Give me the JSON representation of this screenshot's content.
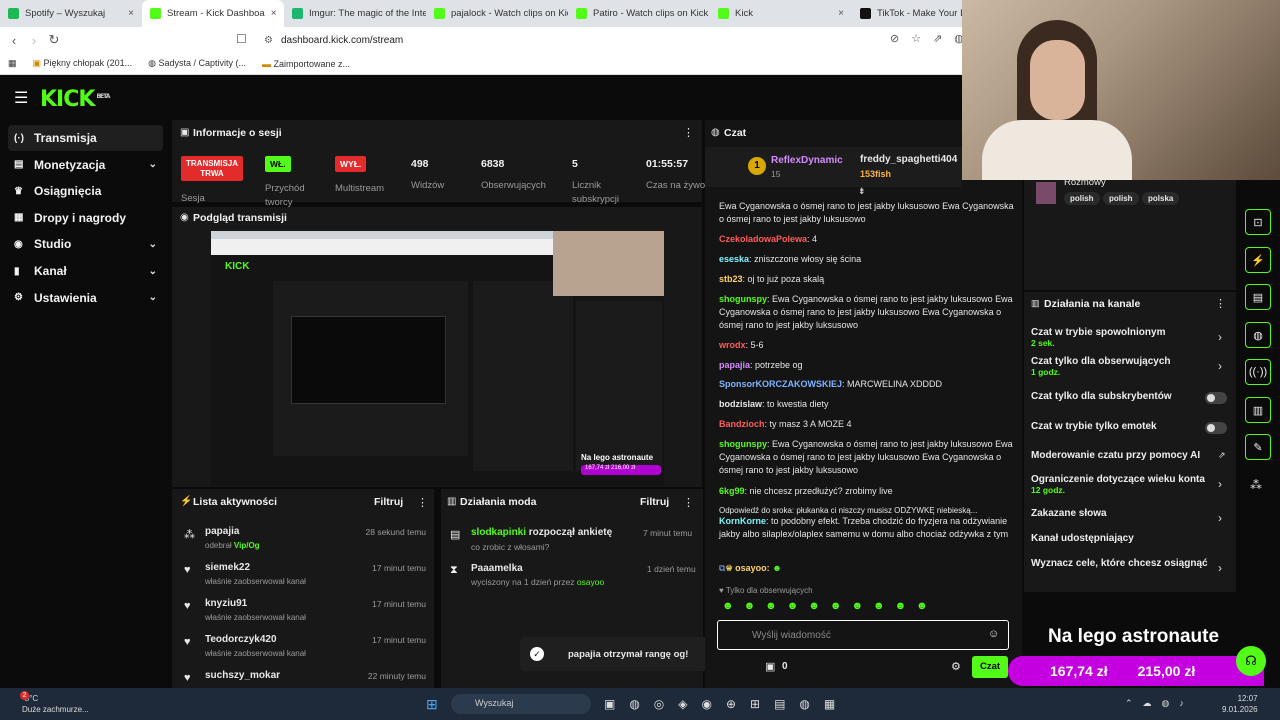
{
  "browser": {
    "tabs": [
      {
        "label": "Spotify – Wyszukaj",
        "color": "#1db954"
      },
      {
        "label": "Stream - Kick Dashboa",
        "color": "#53fc18",
        "active": true
      },
      {
        "label": "Imgur: The magic of the Interne",
        "color": "#1bb76e"
      },
      {
        "label": "pajalock - Watch clips on Kick",
        "color": "#53fc18"
      },
      {
        "label": "Patiro - Watch clips on Kick",
        "color": "#53fc18"
      },
      {
        "label": "Kick",
        "color": "#53fc18"
      },
      {
        "label": "TikTok - Make Your Day",
        "color": "#111111"
      }
    ],
    "url": "dashboard.kick.com/stream",
    "bookmarks": [
      "Piękny chłopak (201...",
      "Sadysta / Captivity (...",
      "Zaimportowane z..."
    ]
  },
  "kick": {
    "logo": "KICK",
    "beta": "BETA",
    "sidebar": [
      {
        "label": "Transmisja",
        "icon": "(·)",
        "selected": true
      },
      {
        "label": "Monetyzacja",
        "icon": "▤",
        "chev": "⌄"
      },
      {
        "label": "Osiągnięcia",
        "icon": "♛"
      },
      {
        "label": "Dropy i nagrody",
        "icon": "▦"
      },
      {
        "label": "Studio",
        "icon": "◉",
        "chev": "⌄"
      },
      {
        "label": "Kanał",
        "icon": "▮",
        "chev": "⌄"
      },
      {
        "label": "Ustawienia",
        "icon": "⚙",
        "chev": "⌄"
      }
    ],
    "session": {
      "title": "Informacje o sesji",
      "live_badge": "TRANSMISJA TRWA",
      "live_sub": "Sesja",
      "subs_badge": "WŁ.",
      "subs_label": "Przychód tworcy",
      "multi_badge": "WYŁ.",
      "multi_label": "Multistream",
      "stats": [
        {
          "value": "498",
          "label": "Widzów"
        },
        {
          "value": "6838",
          "label": "Obserwujących"
        },
        {
          "value": "5",
          "label": "Licznik subskrypcji"
        },
        {
          "value": "01:55:57",
          "label": "Czas na żywo"
        }
      ]
    },
    "preview": {
      "title": "Podgląd transmisji",
      "overlay": "Na lego astronaute",
      "money1": "167,74 zł",
      "money2": "216,00 zł"
    },
    "activity": {
      "title": "Lista aktywności",
      "filter": "Filtruj",
      "items": [
        {
          "user": "papajia",
          "time": "28 sekund temu",
          "desc": "odebrał ",
          "extra": "Vip/Og"
        },
        {
          "user": "siemek22",
          "time": "17 minut temu",
          "desc": "właśnie zaobserwował kanał",
          "extra": ""
        },
        {
          "user": "knyziu91",
          "time": "17 minut temu",
          "desc": "właśnie zaobserwował kanał",
          "extra": ""
        },
        {
          "user": "Teodorczyk420",
          "time": "17 minut temu",
          "desc": "właśnie zaobserwował kanał",
          "extra": ""
        },
        {
          "user": "suchszy_mokar",
          "time": "22 minuty temu",
          "desc": "",
          "extra": ""
        }
      ]
    },
    "mod": {
      "title": "Działania moda",
      "filter": "Filtruj",
      "items": [
        {
          "user": "slodkapinki",
          "action": " rozpoczął ankietę",
          "time": "7 minut temu",
          "desc": "co zrobic z włosami?"
        },
        {
          "user": "Paaamelka",
          "action": "",
          "time": "1 dzień temu",
          "desc": "wyciszony na 1 dzień przez ",
          "by": "osayoo"
        }
      ]
    },
    "toast": "papajia otrzymał rangę og!",
    "chat": {
      "title": "Czat",
      "pinned": [
        {
          "user": "ReflexDynamic",
          "count": "15"
        },
        {
          "user": "freddy_spaghetti404",
          "count": "153fish"
        }
      ],
      "lines": [
        {
          "user": "",
          "color": "#e8e8e8",
          "text": "Ewa Cyganowska o ósmej rano to jest jakby luksusowo  Ewa Cyganowska o ósmej rano to jest jakby luksusowo"
        },
        {
          "user": "CzekoladowaPolewa",
          "color": "#ff5c5c",
          "text": "4"
        },
        {
          "user": "eseska",
          "color": "#7ff5ff",
          "text": "zniszczone włosy się ścina"
        },
        {
          "user": "stb23",
          "color": "#ffd36b",
          "text": "oj to już poza skalą"
        },
        {
          "user": "shogunspy",
          "color": "#53fc18",
          "text": "Ewa Cyganowska o ósmej rano to jest jakby luksusowo  Ewa Cyganowska o ósmej rano to jest jakby luksusowo  Ewa Cyganowska o ósmej rano to jest jakby luksusowo"
        },
        {
          "user": "wrodx",
          "color": "#ff5c5c",
          "text": "5-6"
        },
        {
          "user": "papajia",
          "color": "#d38cff",
          "text": "potrzebe og"
        },
        {
          "user": "SponsorKORCZAKOWSKIEJ",
          "color": "#7fb4ff",
          "text": "MARCWELINA XDDDD"
        },
        {
          "user": "bodzislaw",
          "color": "#e8e8e8",
          "text": "to kwestia diety"
        },
        {
          "user": "Bandzioch",
          "color": "#ff5c5c",
          "text": "ty masz 3 A MOZE 4"
        },
        {
          "user": "shogunspy",
          "color": "#53fc18",
          "text": "Ewa Cyganowska o ósmej rano to jest jakby luksusowo  Ewa Cyganowska o ósmej rano to jest jakby luksusowo  Ewa Cyganowska o ósmej rano to jest jakby luksusowo"
        },
        {
          "user": "6kg99",
          "color": "#53fc18",
          "text": "nie chcesz przedłużyć? zrobimy live"
        }
      ],
      "reply_hint": "Odpowiedź do sroka: płukanka ci niszczy musisz ODŻYWKĘ niebieską...",
      "reply": {
        "user": "KornKorne",
        "color": "#7ff5ff",
        "text": "to podobny efekt. Trzeba chodzić do fryzjera na odżywianie jakby albo silaplex/olaplex samemu w domu albo chociaż odżywka z tym"
      },
      "last": {
        "user": "osayoo:",
        "color": "#ffd36b"
      },
      "followers_only": "Tylko dla obserwujących",
      "placeholder": "Wyślij wiadomość",
      "points": "0",
      "send": "Czat"
    },
    "channel": {
      "category": "Rozmowy",
      "tags": [
        "polish",
        "polish",
        "polska"
      ],
      "title": "Działania na kanale",
      "items": [
        {
          "label": "Czat w trybie spowolnionym",
          "sub": "2 sek.",
          "ctl": "chev"
        },
        {
          "label": "Czat tylko dla obserwujących",
          "sub": "1 godz.",
          "ctl": "chev"
        },
        {
          "label": "Czat tylko dla subskrybentów",
          "sub": "",
          "ctl": "toggle"
        },
        {
          "label": "Czat w trybie tylko emotek",
          "sub": "",
          "ctl": "toggle"
        },
        {
          "label": "Moderowanie czatu przy pomocy AI",
          "sub": "",
          "ctl": "ext"
        },
        {
          "label": "Ograniczenie dotyczące wieku konta",
          "sub": "12 godz.",
          "ctl": "chev"
        },
        {
          "label": "Zakazane słowa",
          "sub": "",
          "ctl": "chev"
        },
        {
          "label": "Kanał udostępniający",
          "sub": "",
          "ctl": ""
        },
        {
          "label": "Wyznacz cele, które chcesz osiągnąć",
          "sub": "",
          "ctl": "chev"
        }
      ]
    },
    "overlay_text": "Na lego astronaute",
    "overlay_money": [
      "167,74 zł",
      "215,00 zł"
    ]
  },
  "taskbar": {
    "temp": "-8°C",
    "weather": "Duże zachmurze...",
    "search": "Wyszukaj",
    "time": "12:07",
    "date": "9.01.2026",
    "badge": "2"
  }
}
